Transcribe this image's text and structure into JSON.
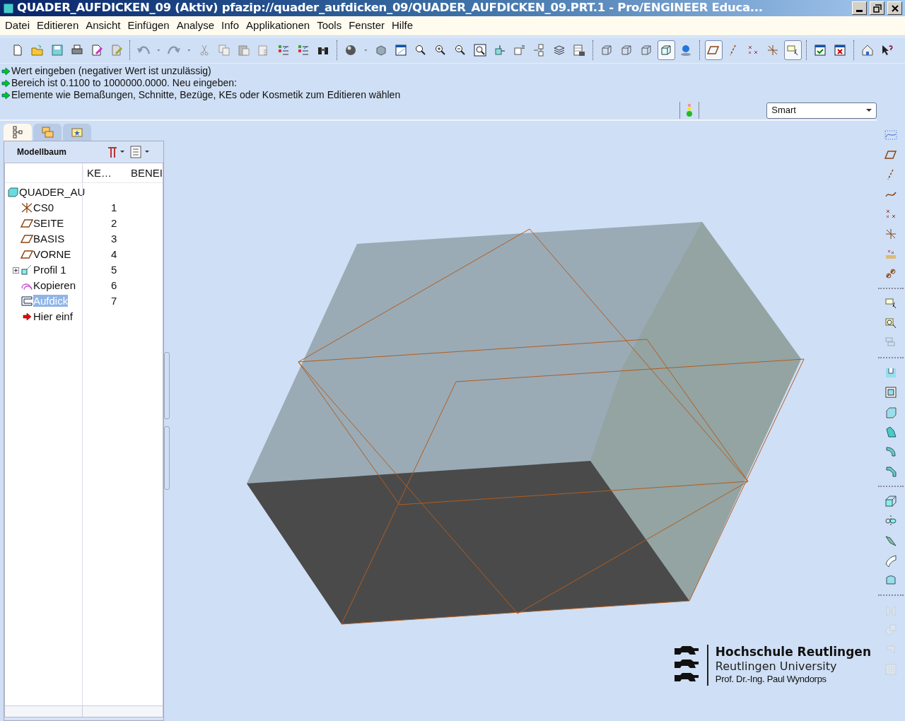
{
  "window": {
    "title": "QUADER_AUFDICKEN_09 (Aktiv) pfazip://quader_aufdicken_09/QUADER_AUFDICKEN_09.PRT.1 - Pro/ENGINEER Educa..."
  },
  "menu": [
    "Datei",
    "Editieren",
    "Ansicht",
    "Einfügen",
    "Analyse",
    "Info",
    "Applikationen",
    "Tools",
    "Fenster",
    "Hilfe"
  ],
  "toolbar": [
    [
      {
        "kind": "new",
        "pressed": false
      },
      {
        "kind": "open",
        "pressed": false
      },
      {
        "kind": "save",
        "pressed": false
      },
      {
        "kind": "print",
        "pressed": false
      },
      {
        "kind": "docpen",
        "pressed": false
      },
      {
        "kind": "docerase",
        "pressed": false
      }
    ],
    [
      {
        "kind": "undo",
        "pressed": false
      },
      {
        "kind": "caret",
        "pressed": false
      },
      {
        "kind": "redo",
        "pressed": false
      },
      {
        "kind": "caret",
        "pressed": false
      },
      {
        "kind": "cut",
        "pressed": false
      },
      {
        "kind": "copy",
        "pressed": false
      },
      {
        "kind": "paste",
        "pressed": false
      },
      {
        "kind": "pastelist",
        "pressed": false
      },
      {
        "kind": "checklist",
        "pressed": false
      },
      {
        "kind": "checklist",
        "pressed": false
      },
      {
        "kind": "binoculars",
        "pressed": false
      }
    ],
    [
      {
        "kind": "sphere",
        "pressed": false
      },
      {
        "kind": "caret",
        "pressed": false
      },
      {
        "kind": "cube",
        "pressed": false
      },
      {
        "kind": "window",
        "pressed": false
      },
      {
        "kind": "zoomcycle",
        "pressed": false
      },
      {
        "kind": "zoomin",
        "pressed": false
      },
      {
        "kind": "zoomout",
        "pressed": false
      },
      {
        "kind": "zoomfit",
        "pressed": false
      },
      {
        "kind": "cubearrow",
        "pressed": false
      },
      {
        "kind": "cubelabel",
        "pressed": false
      },
      {
        "kind": "dots",
        "pressed": false
      },
      {
        "kind": "layers",
        "pressed": false
      },
      {
        "kind": "tablecam",
        "pressed": false
      }
    ],
    [
      {
        "kind": "wire",
        "pressed": false
      },
      {
        "kind": "wire",
        "pressed": false
      },
      {
        "kind": "wire",
        "pressed": false
      },
      {
        "kind": "shaded",
        "pressed": true
      },
      {
        "kind": "globe",
        "pressed": false
      }
    ],
    [
      {
        "kind": "plane",
        "pressed": true
      },
      {
        "kind": "axis",
        "pressed": false
      },
      {
        "kind": "points",
        "pressed": false
      },
      {
        "kind": "csys",
        "pressed": false
      },
      {
        "kind": "note",
        "pressed": true
      }
    ],
    [
      {
        "kind": "wincheck",
        "pressed": false
      },
      {
        "kind": "winclose",
        "pressed": false
      }
    ],
    [
      {
        "kind": "home",
        "pressed": false
      },
      {
        "kind": "help",
        "pressed": false
      }
    ]
  ],
  "messages": [
    "Wert eingeben (negativer Wert ist unzulässig)",
    "Bereich ist 0.1100 to 1000000.0000. Neu eingeben:",
    "Elemente wie Bemaßungen, Schnitte, Bezüge, KEs oder Kosmetik zum Editieren wählen"
  ],
  "filter": {
    "value": "Smart"
  },
  "panel_tabs": [
    {
      "kind": "tree",
      "selected": true
    },
    {
      "kind": "folders",
      "selected": false
    },
    {
      "kind": "favorites",
      "selected": false
    }
  ],
  "model_tree": {
    "title": "Modellbaum",
    "columns": [
      "KE…",
      "BENEI"
    ],
    "root": {
      "name": "QUADER_AU",
      "children": [
        {
          "kind": "csys",
          "name": "CS0",
          "number": "1",
          "selected": false
        },
        {
          "kind": "plane",
          "name": "SEITE",
          "number": "2",
          "selected": false
        },
        {
          "kind": "plane",
          "name": "BASIS",
          "number": "3",
          "selected": false
        },
        {
          "kind": "plane",
          "name": "VORNE",
          "number": "4",
          "selected": false
        },
        {
          "kind": "profile",
          "name": "Profil 1",
          "number": "5",
          "selected": false,
          "expanded": false
        },
        {
          "kind": "copy",
          "name": "Kopieren",
          "number": "6",
          "selected": false
        },
        {
          "kind": "thicken",
          "name": "Aufdick",
          "number": "7",
          "selected": true
        },
        {
          "kind": "insert",
          "name": "Hier einf",
          "selected": false
        }
      ]
    }
  },
  "right_toolbar": [
    [
      {
        "kind": "sketchcurve",
        "disabled": false
      },
      {
        "kind": "plane",
        "disabled": false
      },
      {
        "kind": "axis",
        "disabled": false
      },
      {
        "kind": "curve",
        "disabled": false
      },
      {
        "kind": "points",
        "disabled": false
      },
      {
        "kind": "csys",
        "disabled": false
      },
      {
        "kind": "pointfield",
        "disabled": false
      },
      {
        "kind": "chain",
        "disabled": false
      }
    ],
    [
      {
        "kind": "note",
        "disabled": false
      },
      {
        "kind": "notecircle",
        "disabled": false
      },
      {
        "kind": "notegroup",
        "disabled": true
      }
    ],
    [
      {
        "kind": "hole",
        "disabled": false
      },
      {
        "kind": "shell",
        "disabled": false
      },
      {
        "kind": "rib",
        "disabled": false
      },
      {
        "kind": "draft",
        "disabled": false
      },
      {
        "kind": "round",
        "disabled": false
      },
      {
        "kind": "chamfer",
        "disabled": false
      }
    ],
    [
      {
        "kind": "extrude",
        "disabled": false
      },
      {
        "kind": "revolve",
        "disabled": false
      },
      {
        "kind": "sweep",
        "disabled": false
      },
      {
        "kind": "surface",
        "disabled": false
      },
      {
        "kind": "blend",
        "disabled": false
      }
    ],
    [
      {
        "kind": "mirror",
        "disabled": true
      },
      {
        "kind": "merge",
        "disabled": true
      },
      {
        "kind": "trim",
        "disabled": true
      },
      {
        "kind": "pattern",
        "disabled": true
      }
    ]
  ],
  "logo": {
    "title": "Hochschule Reutlingen",
    "subtitle": "Reutlingen University",
    "author": "Prof. Dr.-Ing. Paul Wyndorps"
  }
}
